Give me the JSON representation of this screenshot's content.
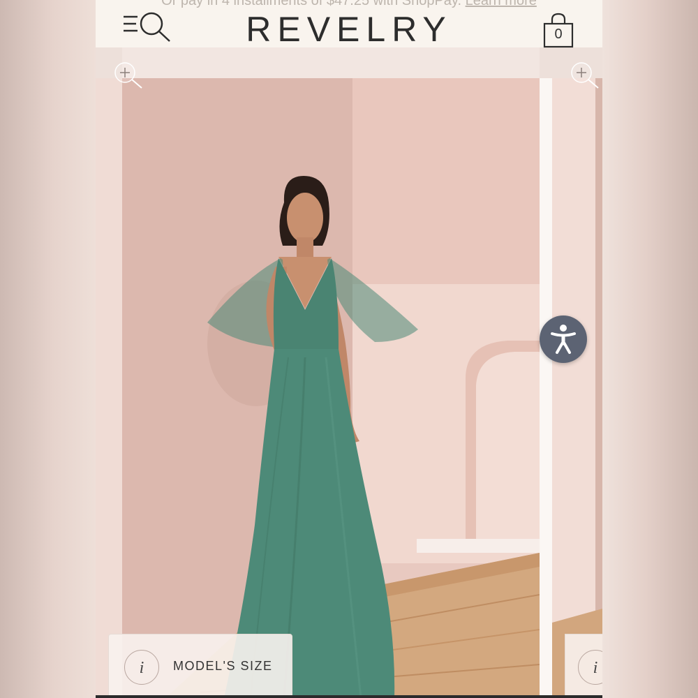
{
  "promo": {
    "text": "Or pay in 4 installments of $47.25 with ShopPay.",
    "link": "Learn more"
  },
  "header": {
    "logo": "REVELRY",
    "cart_count": "0",
    "menu_icon": "hamburger-search-icon",
    "cart_icon": "shopping-bag-icon"
  },
  "gallery": {
    "zoom_icon": "zoom-plus-icon",
    "image_alt": "Model wearing a green tulle maxi dress with flutter sleeves",
    "dress_color": "#4d8a78"
  },
  "accessibility": {
    "icon": "accessibility-person-icon",
    "color": "#5c6373"
  },
  "model_size": {
    "info_glyph": "i",
    "label": "MODEL'S SIZE"
  }
}
